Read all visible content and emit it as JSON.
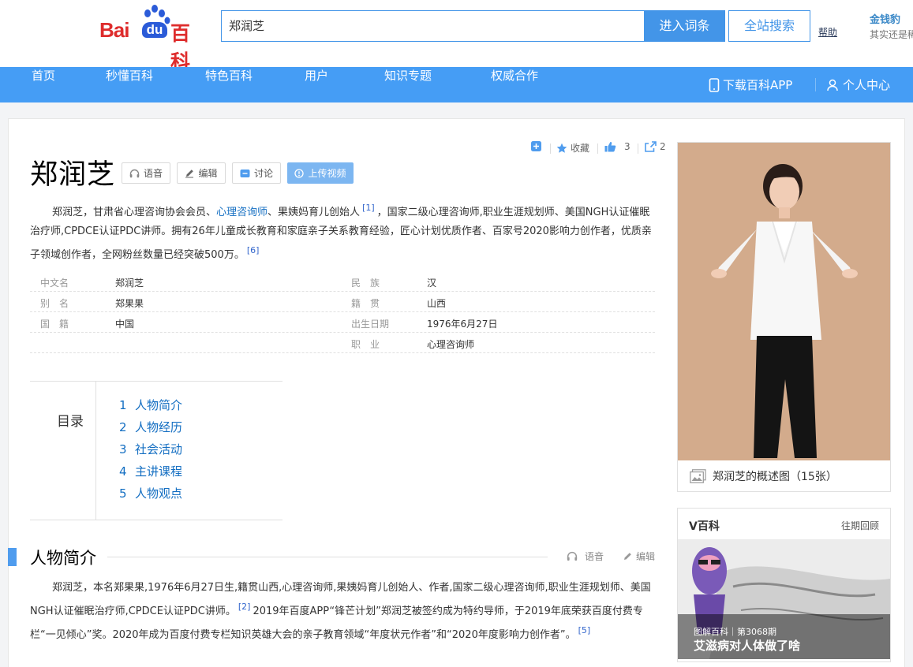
{
  "header": {
    "logo_text": "Baidu百科",
    "search_value": "郑润芝",
    "enter_button": "进入词条",
    "search_all_button": "全站搜索",
    "help_link": "帮助",
    "ad_title": "金钱豹",
    "ad_subtitle": "其实还是稀"
  },
  "nav": {
    "items": [
      "首页",
      "秒懂百科",
      "特色百科",
      "用户",
      "知识专题",
      "权威合作"
    ],
    "download_app": "下载百科APP",
    "user_center": "个人中心"
  },
  "actions": {
    "collect": "收藏",
    "like_count": "3",
    "share_count": "2"
  },
  "entry": {
    "title": "郑润芝",
    "btn_voice": "语音",
    "btn_edit": "编辑",
    "btn_discuss": "讨论",
    "btn_upload_video": "上传视频"
  },
  "summary": {
    "part1": "郑润芝，甘肃省心理咨询协会会员、",
    "link": "心理咨询师",
    "part2": "、果姨妈育儿创始人",
    "ref1": "[1]",
    "part3": "，国家二级心理咨询师,职业生涯规划师、美国NGH认证催眠治疗师,CPDCE认证PDC讲师。拥有26年儿童成长教育和家庭亲子关系教育经验，匠心计划优质作者、百家号2020影响力创作者，优质亲子领域创作者，全网粉丝数量已经突破500万。",
    "ref2": "[6]"
  },
  "basic_info": [
    {
      "left_key": "中文名",
      "left_value": "郑润芝",
      "right_key": "民　族",
      "right_value": "汉"
    },
    {
      "left_key": "别　名",
      "left_value": "郑果果",
      "right_key": "籍　贯",
      "right_value": "山西"
    },
    {
      "left_key": "国　籍",
      "left_value": "中国",
      "right_key": "出生日期",
      "right_value": "1976年6月27日"
    },
    {
      "left_key": "",
      "left_value": "",
      "right_key": "职　业",
      "right_value": "心理咨询师"
    }
  ],
  "toc": {
    "title": "目录",
    "items": [
      {
        "num": "1",
        "label": "人物简介"
      },
      {
        "num": "2",
        "label": "人物经历"
      },
      {
        "num": "3",
        "label": "社会活动"
      },
      {
        "num": "4",
        "label": "主讲课程"
      },
      {
        "num": "5",
        "label": "人物观点"
      }
    ]
  },
  "section": {
    "title": "人物简介",
    "voice": "语音",
    "edit": "编辑",
    "text1": "郑润芝，本名郑果果,1976年6月27日生,籍贯山西,心理咨询师,果姨妈育儿创始人、作者,国家二级心理咨询师,职业生涯规划师、美国NGH认证催眠治疗师,CPDCE认证PDC讲师。",
    "ref1": "[2]",
    "text2": "2019年百度APP“锋芒计划”郑润芝被签约成为特约导师，于2019年底荣获百度付费专栏“一见倾心”奖。2020年成为百度付费专栏知识英雄大会的亲子教育领域“年度状元作者”和“2020年度影响力创作者”。",
    "ref2": "[5]"
  },
  "album": {
    "caption": "郑润芝的概述图（15张）"
  },
  "vbaike": {
    "title": "V百科",
    "more": "往期回顾",
    "tag": "图解百科｜第3068期",
    "caption": "艾滋病对人体做了啥"
  }
}
